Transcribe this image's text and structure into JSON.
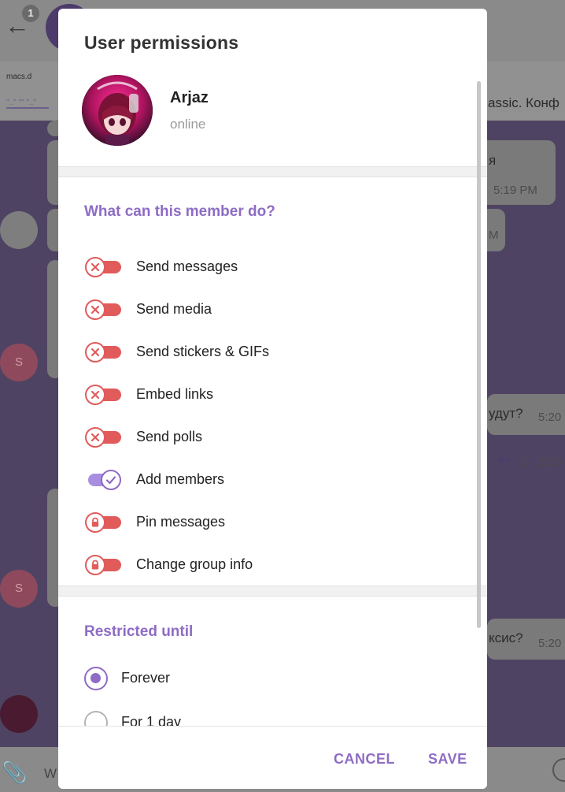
{
  "background": {
    "unread_count": "1",
    "pinned_title": "macs.d",
    "pinned_link": "\"..\" \"\" \"..\"",
    "pinned_text": "assic. Конф",
    "messages": [
      {
        "text": "я",
        "time": "5:19 PM"
      },
      {
        "text": "",
        "time": "M"
      },
      {
        "text": "удут?",
        "time": "5:20"
      },
      {
        "text": "",
        "time": "5:20",
        "reply_count": "1"
      },
      {
        "text": "ксис?",
        "time": "5:20"
      }
    ],
    "avatar_letter": "S",
    "input_prefix": "W"
  },
  "dialog": {
    "title": "User permissions",
    "user": {
      "name": "Arjaz",
      "status": "online"
    },
    "permissions_title": "What can this member do?",
    "permissions": [
      {
        "label": "Send messages",
        "state": "off",
        "icon": "x-icon"
      },
      {
        "label": "Send media",
        "state": "off",
        "icon": "x-icon"
      },
      {
        "label": "Send stickers & GIFs",
        "state": "off",
        "icon": "x-icon"
      },
      {
        "label": "Embed links",
        "state": "off",
        "icon": "x-icon"
      },
      {
        "label": "Send polls",
        "state": "off",
        "icon": "x-icon"
      },
      {
        "label": "Add members",
        "state": "on",
        "icon": "check-icon"
      },
      {
        "label": "Pin messages",
        "state": "off",
        "icon": "lock-icon"
      },
      {
        "label": "Change group info",
        "state": "off",
        "icon": "lock-icon"
      }
    ],
    "restricted_title": "Restricted until",
    "restricted_options": [
      {
        "label": "Forever",
        "checked": true
      },
      {
        "label": "For 1 day",
        "checked": false
      }
    ],
    "cancel_label": "CANCEL",
    "save_label": "SAVE"
  },
  "colors": {
    "accent": "#8e6cc4",
    "toggle_off": "#e15b5b",
    "toggle_on_track": "#a98de0"
  }
}
